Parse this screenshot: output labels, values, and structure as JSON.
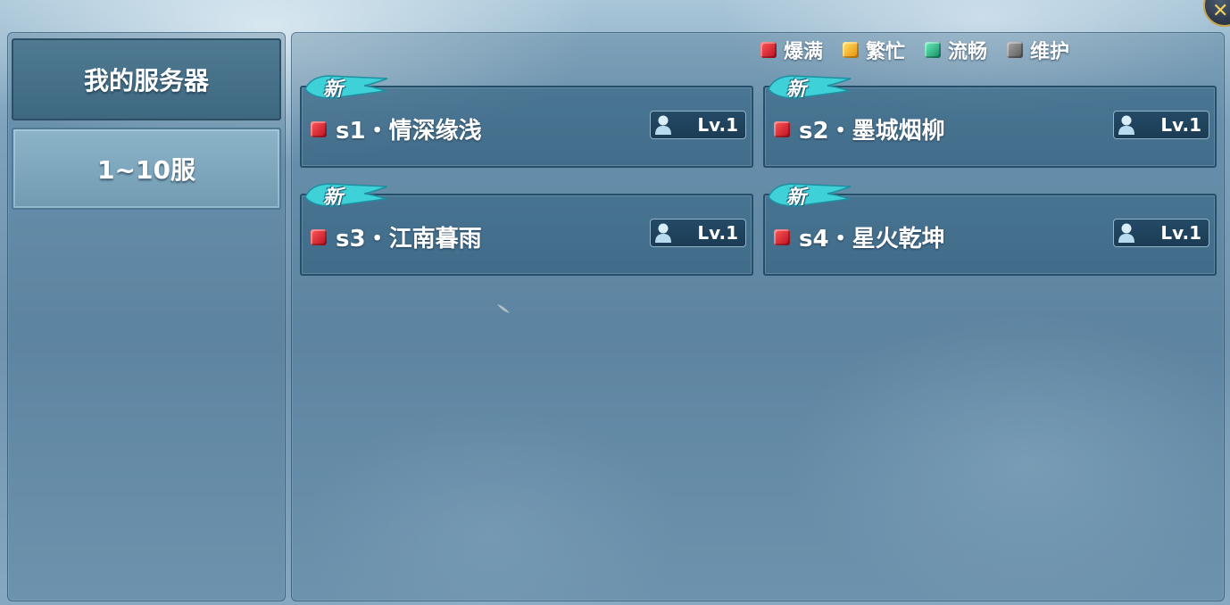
{
  "sidebar": {
    "items": [
      {
        "label": "我的服务器",
        "selected": false
      },
      {
        "label": "1~10服",
        "selected": true
      }
    ]
  },
  "legend": {
    "items": [
      {
        "label": "爆满",
        "color": "#d9202e"
      },
      {
        "label": "繁忙",
        "color": "#f5b021"
      },
      {
        "label": "流畅",
        "color": "#1fbf88"
      },
      {
        "label": "维护",
        "color": "#808080"
      }
    ]
  },
  "servers": [
    {
      "tag": "新",
      "name": "s1・情深缘浅",
      "status": "爆满",
      "level": "Lv.1"
    },
    {
      "tag": "新",
      "name": "s2・墨城烟柳",
      "status": "爆满",
      "level": "Lv.1"
    },
    {
      "tag": "新",
      "name": "s3・江南暮雨",
      "status": "爆满",
      "level": "Lv.1"
    },
    {
      "tag": "新",
      "name": "s4・星火乾坤",
      "status": "爆满",
      "level": "Lv.1"
    }
  ],
  "icons": {
    "close": "close-icon",
    "status": "status-gem-icon",
    "player": "person-icon"
  }
}
